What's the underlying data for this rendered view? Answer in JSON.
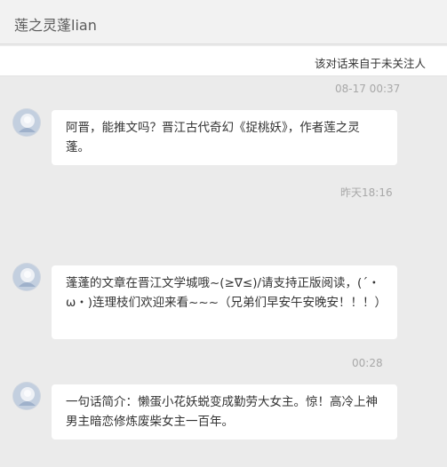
{
  "header": {
    "title": "莲之灵蓬lian"
  },
  "notice": {
    "text": "该对话来自于未关注人"
  },
  "messages": [
    {
      "timestamp": "08-17 00:37",
      "text": "阿晋，能推文吗？晋江古代奇幻《捉桃妖》，作者莲之灵蓬。"
    },
    {
      "timestamp": "昨天18:16",
      "text": ""
    },
    {
      "timestamp": "",
      "text": "蓬蓬的文章在晋江文学城哦~(≥∇≤)/请支持正版阅读，(´・ω・)连理枝们欢迎来看~~~（兄弟们早安午安晚安！！！）"
    },
    {
      "timestamp": "00:28",
      "text": "一句话简介：懒蛋小花妖蜕变成勤劳大女主。惊！高冷上神男主暗恋修炼废柴女主一百年。"
    }
  ]
}
